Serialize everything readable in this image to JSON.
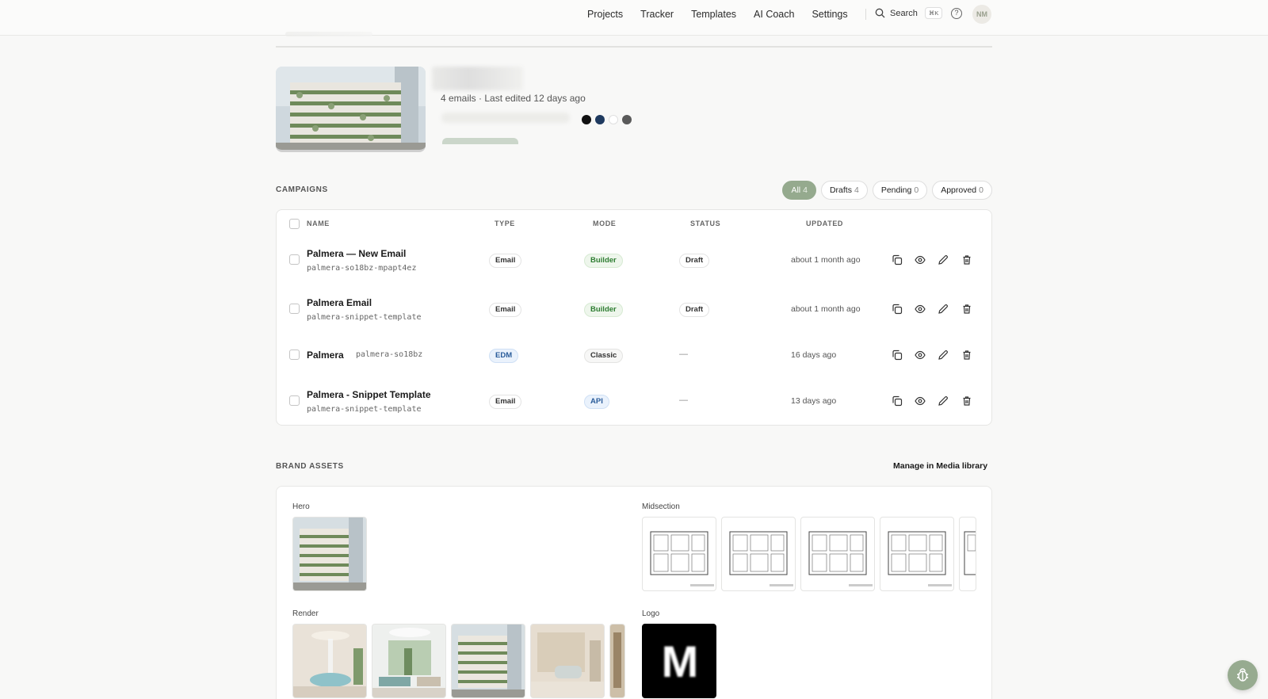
{
  "nav": {
    "links": [
      "Projects",
      "Tracker",
      "Templates",
      "AI Coach",
      "Settings"
    ],
    "search_label": "Search",
    "search_shortcut": "⌘K",
    "avatar_initials": "NM"
  },
  "project": {
    "meta": "4 emails · Last edited 12 days ago",
    "palette": [
      "#111111",
      "#1f3a5f",
      "#ffffff",
      "#5a5a5a"
    ]
  },
  "campaigns": {
    "section_label": "CAMPAIGNS",
    "filters": [
      {
        "label": "All",
        "count": "4"
      },
      {
        "label": "Drafts",
        "count": "4"
      },
      {
        "label": "Pending",
        "count": "0"
      },
      {
        "label": "Approved",
        "count": "0"
      }
    ],
    "columns": [
      "NAME",
      "TYPE",
      "MODE",
      "STATUS",
      "UPDATED"
    ],
    "rows": [
      {
        "name": "Palmera — New Email",
        "slug": "palmera-so18bz-mpapt4ez",
        "type": "Email",
        "mode": "Builder",
        "status": "Draft",
        "updated": "about 1 month ago"
      },
      {
        "name": "Palmera Email",
        "slug": "palmera-snippet-template",
        "type": "Email",
        "mode": "Builder",
        "status": "Draft",
        "updated": "about 1 month ago"
      },
      {
        "name": "Palmera",
        "slug": "palmera-so18bz",
        "type": "EDM",
        "mode": "Classic",
        "status": "—",
        "updated": "16 days ago"
      },
      {
        "name": "Palmera - Snippet Template",
        "slug": "palmera-snippet-template",
        "type": "Email",
        "mode": "API",
        "status": "—",
        "updated": "13 days ago"
      }
    ]
  },
  "brand_assets": {
    "section_label": "BRAND ASSETS",
    "manage_link": "Manage in Media library",
    "groups": {
      "hero": "Hero",
      "midsection": "Midsection",
      "render": "Render",
      "logo": "Logo"
    },
    "logo_letter": "M"
  },
  "colors": {
    "accent": "#95aa8e",
    "builder": "#2e7d32",
    "edm": "#2a5c9a"
  }
}
